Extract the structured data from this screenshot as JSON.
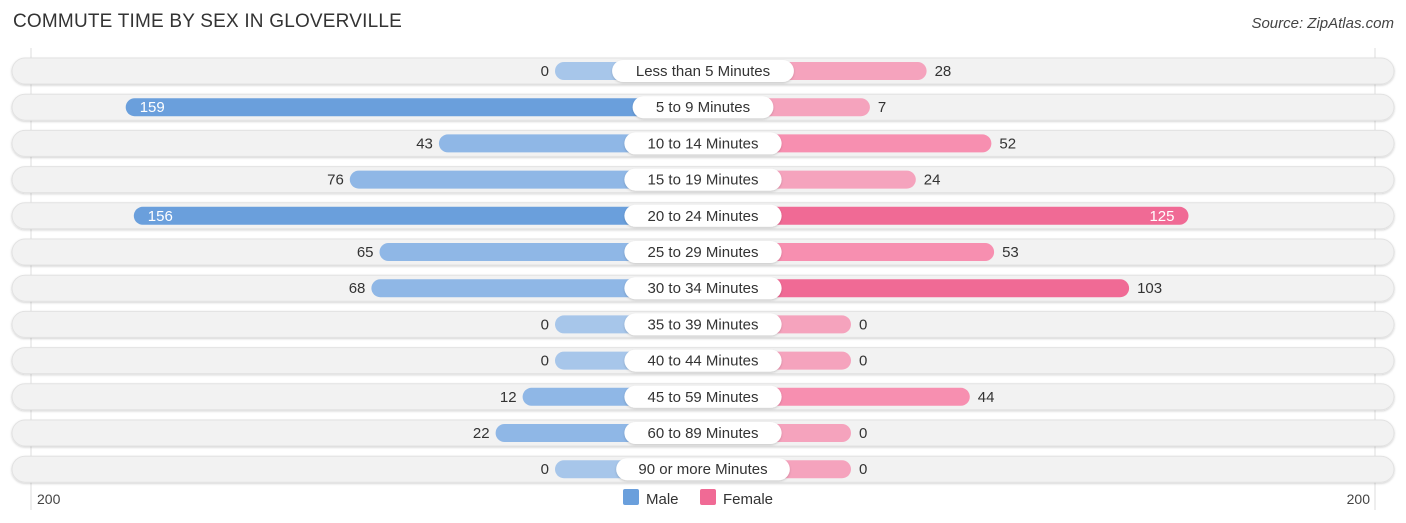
{
  "title": "COMMUTE TIME BY SEX IN GLOVERVILLE",
  "source": "Source: ZipAtlas.com",
  "colors": {
    "male": "#6a9fdc",
    "male_light": "#a7c6ea",
    "female": "#f06a95",
    "female_light": "#f5a3bd",
    "track": "#f2f2f2"
  },
  "chart_data": {
    "type": "bar",
    "orientation": "horizontal-diverging",
    "title": "COMMUTE TIME BY SEX IN GLOVERVILLE",
    "categories": [
      "Less than 5 Minutes",
      "5 to 9 Minutes",
      "10 to 14 Minutes",
      "15 to 19 Minutes",
      "20 to 24 Minutes",
      "25 to 29 Minutes",
      "30 to 34 Minutes",
      "35 to 39 Minutes",
      "40 to 44 Minutes",
      "45 to 59 Minutes",
      "60 to 89 Minutes",
      "90 or more Minutes"
    ],
    "series": [
      {
        "name": "Male",
        "values": [
          0,
          159,
          43,
          76,
          156,
          65,
          68,
          0,
          0,
          12,
          22,
          0
        ]
      },
      {
        "name": "Female",
        "values": [
          28,
          7,
          52,
          24,
          125,
          53,
          103,
          0,
          0,
          44,
          0,
          0
        ]
      }
    ],
    "axis": {
      "left_label": "200",
      "right_label": "200",
      "max": 200
    },
    "legend": {
      "position": "bottom-center",
      "items": [
        "Male",
        "Female"
      ]
    }
  }
}
